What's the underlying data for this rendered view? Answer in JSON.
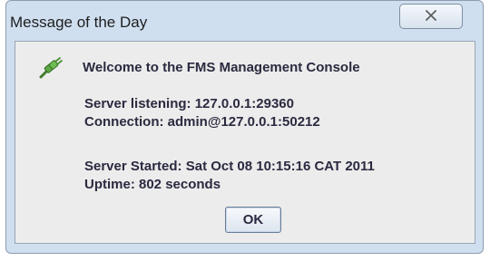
{
  "window": {
    "title": "Message of the Day",
    "close_glyph": "☒"
  },
  "message": {
    "icon": "plug-connector-icon",
    "welcome": "Welcome to the FMS Management Console",
    "server_listening": "Server listening: 127.0.0.1:29360",
    "connection": "Connection: admin@127.0.0.1:50212",
    "server_started": "Server Started: Sat Oct 08 10:15:16 CAT 2011",
    "uptime": "Uptime: 802 seconds"
  },
  "buttons": {
    "ok_label": "OK"
  },
  "colors": {
    "frame": "#cfdff0",
    "client_bg": "#ececec",
    "text": "#2a2a40",
    "icon_green": "#4f9a3a"
  }
}
